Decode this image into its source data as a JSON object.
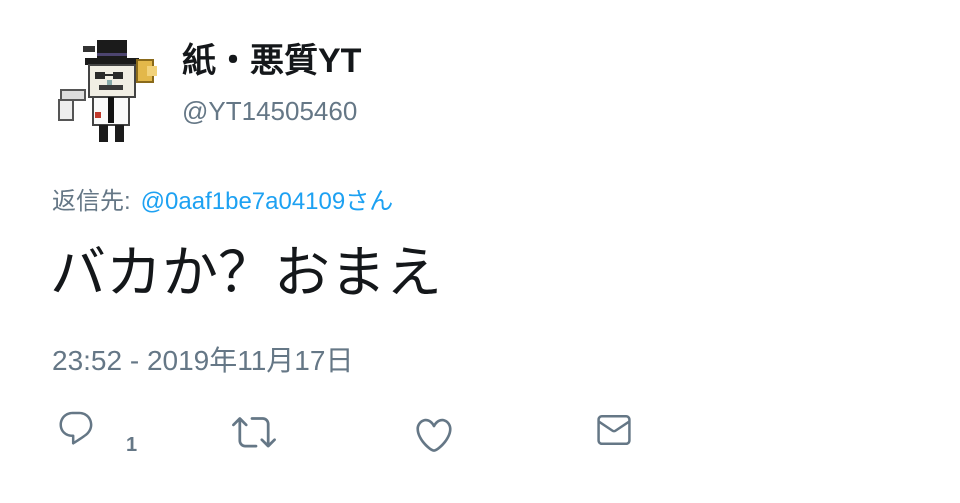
{
  "colors": {
    "text": "#14171a",
    "secondary": "#657786",
    "link": "#1da1f2",
    "background": "#ffffff"
  },
  "tweet": {
    "author": {
      "avatar_icon": "pixel-art-character-avatar",
      "display_name": "紙・悪質YT",
      "handle": "@YT14505460"
    },
    "reply_to": {
      "prefix": "返信先:",
      "handle": "@0aaf1be7a04109",
      "suffix": "さん"
    },
    "text": "バカか？おまえ",
    "timestamp": "23:52 - 2019年11月17日",
    "actions": {
      "reply": {
        "icon": "reply-icon",
        "count": "1"
      },
      "retweet": {
        "icon": "retweet-icon"
      },
      "like": {
        "icon": "heart-icon"
      },
      "direct_message": {
        "icon": "envelope-icon"
      }
    }
  }
}
